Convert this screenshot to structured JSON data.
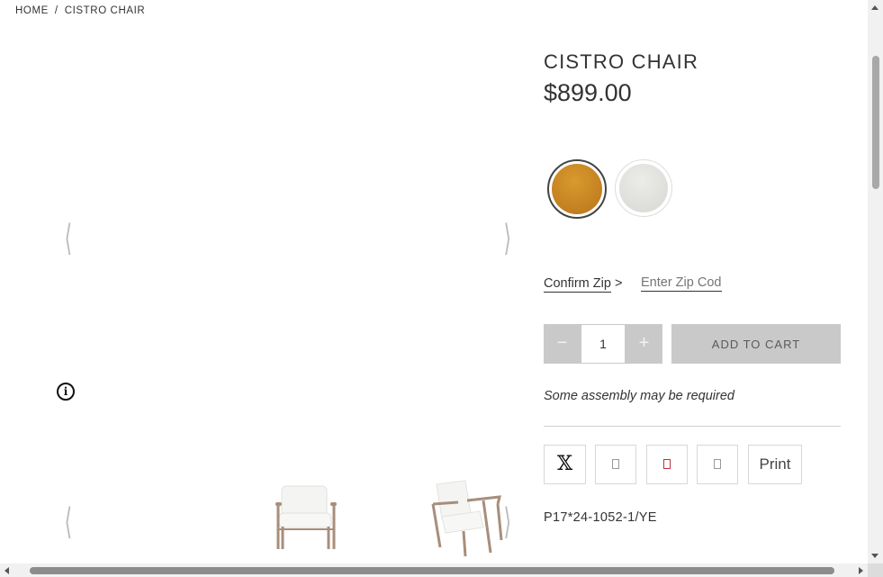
{
  "breadcrumb": {
    "home": "HOME",
    "separator": "/",
    "current": "CISTRO CHAIR"
  },
  "gallery": {
    "prev_glyph": "⟨",
    "next_glyph": "⟩",
    "info_glyph": "i",
    "thumbs_prev_glyph": "⟨",
    "thumbs_next_glyph": "⟩"
  },
  "product": {
    "title": "CISTRO CHAIR",
    "price": "$899.00",
    "sku": "P17*24-1052-1/YE"
  },
  "swatches": [
    {
      "name": "gold",
      "color": "#c8861f",
      "selected": true
    },
    {
      "name": "white",
      "color": "#e0e0dc",
      "selected": false
    }
  ],
  "zip": {
    "confirm_label": "Confirm Zip",
    "arrow": ">",
    "placeholder": "Enter Zip Code"
  },
  "cart": {
    "minus": "−",
    "plus": "+",
    "quantity": "1",
    "add_label": "ADD TO CART"
  },
  "assembly_note": "Some assembly may be required",
  "share": {
    "x_glyph": "𝕏",
    "print_label": "Print"
  },
  "colors": {
    "button_gray": "#c9c9c9",
    "text": "#333333"
  }
}
